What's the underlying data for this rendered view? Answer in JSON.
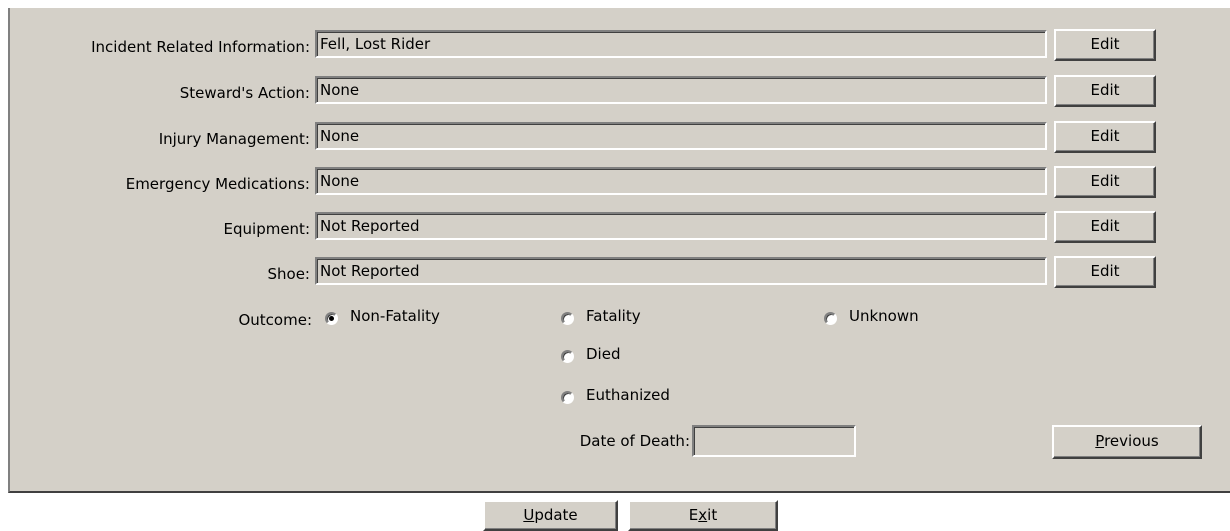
{
  "rows": [
    {
      "label": "Incident Related Information:",
      "value": "Fell, Lost Rider",
      "button": "Edit"
    },
    {
      "label": "Steward's Action:",
      "value": "None",
      "button": "Edit"
    },
    {
      "label": "Injury Management:",
      "value": "None",
      "button": "Edit"
    },
    {
      "label": "Emergency Medications:",
      "value": "None",
      "button": "Edit"
    },
    {
      "label": "Equipment:",
      "value": "Not Reported",
      "button": "Edit"
    },
    {
      "label": "Shoe:",
      "value": "Not Reported",
      "button": "Edit"
    }
  ],
  "outcome": {
    "label": "Outcome:",
    "selected": "Non-Fatality",
    "options": {
      "non_fatality": "Non-Fatality",
      "fatality": "Fatality",
      "unknown": "Unknown",
      "died": "Died",
      "euthanized": "Euthanized"
    }
  },
  "date_of_death": {
    "label": "Date of Death:",
    "value": ""
  },
  "buttons": {
    "previous": {
      "mnemonic": "P",
      "rest": "revious"
    },
    "update": {
      "mnemonic": "U",
      "rest": "pdate"
    },
    "exit": {
      "pre": "E",
      "mnemonic": "x",
      "rest": "it"
    }
  }
}
